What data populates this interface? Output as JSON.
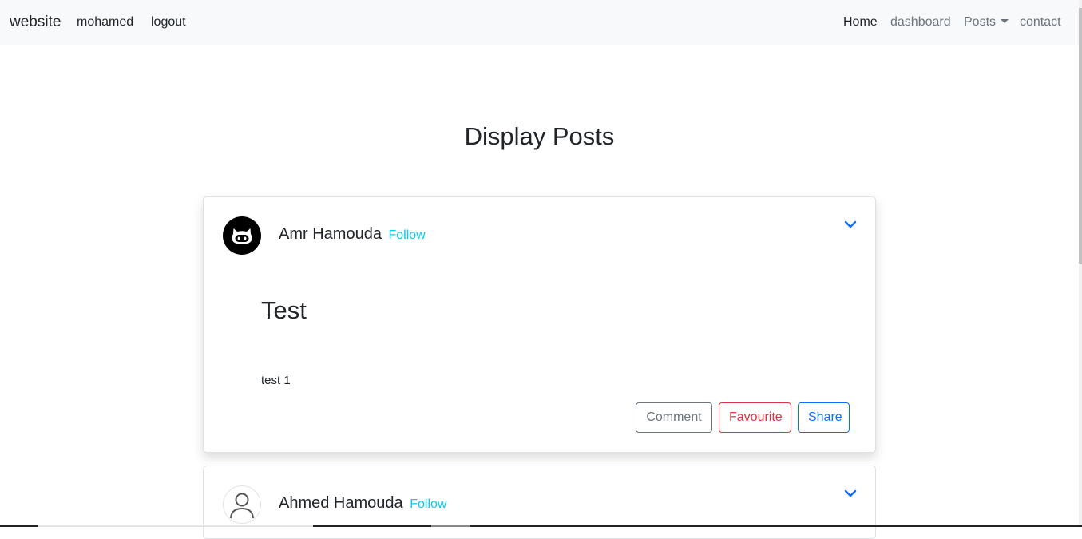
{
  "navbar": {
    "brand": "website",
    "user": "mohamed",
    "logout": "logout",
    "home": "Home",
    "dashboard": "dashboard",
    "posts": "Posts",
    "contact": "contact"
  },
  "page": {
    "title": "Display Posts"
  },
  "posts": [
    {
      "author": "Amr Hamouda",
      "follow": "Follow",
      "avatar_icon": "github-octocat-icon",
      "title": "Test",
      "body": "test 1",
      "actions": {
        "comment": "Comment",
        "favourite": "Favourite",
        "share": "Share"
      }
    },
    {
      "author": "Ahmed Hamouda",
      "follow": "Follow",
      "avatar_icon": "user-outline-icon"
    }
  ],
  "colors": {
    "navbar_bg": "#f8f9fa",
    "follow": "#0dcaf0",
    "comment": "#6c757d",
    "favourite": "#dc3545",
    "share": "#0d6efd"
  }
}
